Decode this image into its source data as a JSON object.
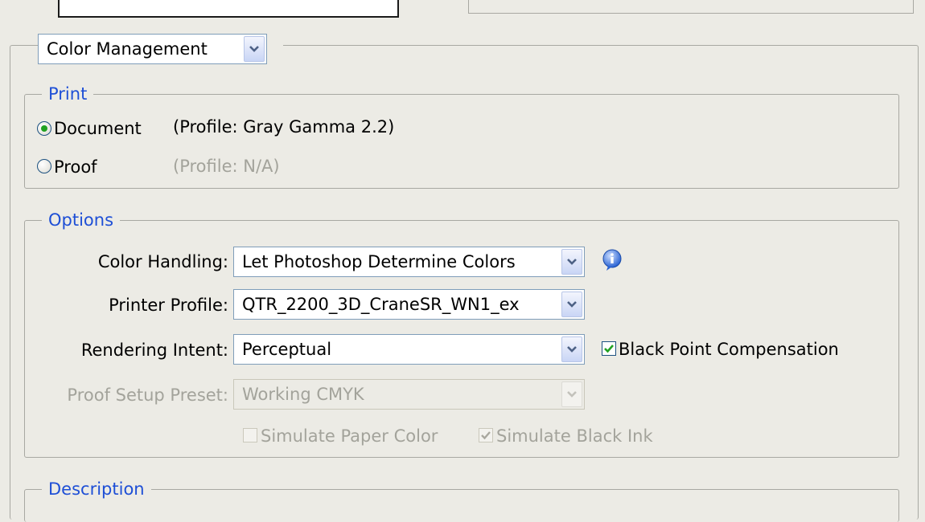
{
  "color_management_select": {
    "value": "Color Management"
  },
  "print_group": {
    "legend": "Print",
    "document_radio": {
      "label": "Document",
      "profile": "(Profile: Gray Gamma 2.2)",
      "checked": true
    },
    "proof_radio": {
      "label": "Proof",
      "profile": "(Profile: N/A)",
      "checked": false
    }
  },
  "options_group": {
    "legend": "Options",
    "color_handling": {
      "label": "Color Handling:",
      "value": "Let Photoshop Determine Colors"
    },
    "printer_profile": {
      "label": "Printer Profile:",
      "value": "QTR_2200_3D_CraneSR_WN1_ex"
    },
    "rendering_intent": {
      "label": "Rendering Intent:",
      "value": "Perceptual"
    },
    "black_point_compensation": {
      "label": "Black Point Compensation",
      "checked": true
    },
    "proof_setup_preset": {
      "label": "Proof Setup Preset:",
      "value": "Working CMYK",
      "disabled": true
    },
    "simulate_paper_color": {
      "label": "Simulate Paper Color",
      "checked": false,
      "disabled": true
    },
    "simulate_black_ink": {
      "label": "Simulate Black Ink",
      "checked": true,
      "disabled": true
    }
  },
  "description_group": {
    "legend": "Description"
  },
  "icons": {
    "info": "info-icon",
    "dropdown": "chevron-down-icon",
    "check": "checkmark-icon"
  },
  "colors": {
    "accent_legend": "#1e4fd6",
    "radio_selected": "#21a121",
    "disabled_text": "#a3a39b",
    "info_blue": "#2a63d3"
  }
}
